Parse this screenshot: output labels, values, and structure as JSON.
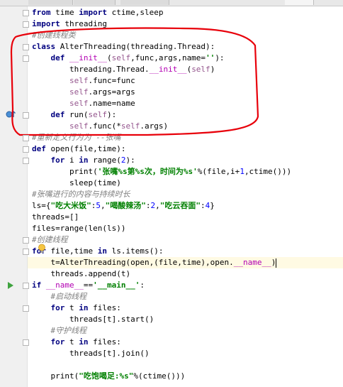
{
  "editor": {
    "lines": [
      [
        {
          "t": "from ",
          "c": "k"
        },
        {
          "t": "time ",
          "c": ""
        },
        {
          "t": "import ",
          "c": "k"
        },
        {
          "t": "ctime,sleep",
          "c": ""
        }
      ],
      [
        {
          "t": "import ",
          "c": "k"
        },
        {
          "t": "threading",
          "c": ""
        }
      ],
      [
        {
          "t": "#创建线程类",
          "c": "c"
        }
      ],
      [
        {
          "t": "class ",
          "c": "k"
        },
        {
          "t": "AlterThreading(threading.Thread):",
          "c": ""
        }
      ],
      [
        {
          "t": "    def ",
          "c": "k"
        },
        {
          "t": "__init__",
          "c": "mg"
        },
        {
          "t": "(",
          "c": ""
        },
        {
          "t": "self",
          "c": "sf"
        },
        {
          "t": ",func,args,name=",
          "c": ""
        },
        {
          "t": "''",
          "c": "s"
        },
        {
          "t": "):",
          "c": ""
        }
      ],
      [
        {
          "t": "        threading.Thread.",
          "c": ""
        },
        {
          "t": "__init__",
          "c": "mg"
        },
        {
          "t": "(",
          "c": ""
        },
        {
          "t": "self",
          "c": "sf"
        },
        {
          "t": ")",
          "c": ""
        }
      ],
      [
        {
          "t": "        ",
          "c": ""
        },
        {
          "t": "self",
          "c": "sf"
        },
        {
          "t": ".func=func",
          "c": ""
        }
      ],
      [
        {
          "t": "        ",
          "c": ""
        },
        {
          "t": "self",
          "c": "sf"
        },
        {
          "t": ".args=args",
          "c": ""
        }
      ],
      [
        {
          "t": "        ",
          "c": ""
        },
        {
          "t": "self",
          "c": "sf"
        },
        {
          "t": ".name=name",
          "c": ""
        }
      ],
      [
        {
          "t": "    def ",
          "c": "k"
        },
        {
          "t": "run",
          "c": ""
        },
        {
          "t": "(",
          "c": ""
        },
        {
          "t": "self",
          "c": "sf"
        },
        {
          "t": "):",
          "c": ""
        }
      ],
      [
        {
          "t": "        ",
          "c": ""
        },
        {
          "t": "self",
          "c": "sf"
        },
        {
          "t": ".func(*",
          "c": ""
        },
        {
          "t": "self",
          "c": "sf"
        },
        {
          "t": ".args)",
          "c": ""
        }
      ],
      [
        {
          "t": "#重新定义行为为 --张嘴",
          "c": "c"
        }
      ],
      [
        {
          "t": "def ",
          "c": "k"
        },
        {
          "t": "open(file,time):",
          "c": ""
        }
      ],
      [
        {
          "t": "    for ",
          "c": "k"
        },
        {
          "t": "i ",
          "c": ""
        },
        {
          "t": "in ",
          "c": "k"
        },
        {
          "t": "range(",
          "c": ""
        },
        {
          "t": "2",
          "c": "n"
        },
        {
          "t": "):",
          "c": ""
        }
      ],
      [
        {
          "t": "        print(",
          "c": ""
        },
        {
          "t": "'张嘴%s第%s次，时间为%s'",
          "c": "s"
        },
        {
          "t": "%(file,i+",
          "c": ""
        },
        {
          "t": "1",
          "c": "n"
        },
        {
          "t": ",ctime()))",
          "c": ""
        }
      ],
      [
        {
          "t": "        sleep(time)",
          "c": ""
        }
      ],
      [
        {
          "t": "#张嘴进行的内容与持续时长",
          "c": "c"
        }
      ],
      [
        {
          "t": "ls={",
          "c": ""
        },
        {
          "t": "\"吃大米饭\"",
          "c": "s"
        },
        {
          "t": ":",
          "c": ""
        },
        {
          "t": "5",
          "c": "n"
        },
        {
          "t": ",",
          "c": ""
        },
        {
          "t": "\"喝酸辣汤\"",
          "c": "s"
        },
        {
          "t": ":",
          "c": ""
        },
        {
          "t": "2",
          "c": "n"
        },
        {
          "t": ",",
          "c": ""
        },
        {
          "t": "\"吃云吞面\"",
          "c": "s"
        },
        {
          "t": ":",
          "c": ""
        },
        {
          "t": "4",
          "c": "n"
        },
        {
          "t": "}",
          "c": ""
        }
      ],
      [
        {
          "t": "threads=[]",
          "c": ""
        }
      ],
      [
        {
          "t": "files=range(len(ls))",
          "c": ""
        }
      ],
      [
        {
          "t": "#创建线程",
          "c": "c"
        }
      ],
      [
        {
          "t": "for ",
          "c": "k"
        },
        {
          "t": "file,time ",
          "c": ""
        },
        {
          "t": "in ",
          "c": "k"
        },
        {
          "t": "ls.items():",
          "c": ""
        }
      ],
      [
        {
          "t": "    t=AlterThreading(open,(file,time),open.",
          "c": ""
        },
        {
          "t": "__name__",
          "c": "dn"
        },
        {
          "t": ")",
          "c": ""
        }
      ],
      [
        {
          "t": "    threads.append(t)",
          "c": ""
        }
      ],
      [
        {
          "t": "if ",
          "c": "k"
        },
        {
          "t": "__name__",
          "c": "dn"
        },
        {
          "t": "==",
          "c": ""
        },
        {
          "t": "'__main__'",
          "c": "s"
        },
        {
          "t": ":",
          "c": ""
        }
      ],
      [
        {
          "t": "    #启动线程",
          "c": "c"
        }
      ],
      [
        {
          "t": "    for ",
          "c": "k"
        },
        {
          "t": "t ",
          "c": ""
        },
        {
          "t": "in ",
          "c": "k"
        },
        {
          "t": "files:",
          "c": ""
        }
      ],
      [
        {
          "t": "        threads[t].start()",
          "c": ""
        }
      ],
      [
        {
          "t": "    #守护线程",
          "c": "c"
        }
      ],
      [
        {
          "t": "    for ",
          "c": "k"
        },
        {
          "t": "t ",
          "c": ""
        },
        {
          "t": "in ",
          "c": "k"
        },
        {
          "t": "files:",
          "c": ""
        }
      ],
      [
        {
          "t": "        threads[t].join()",
          "c": ""
        }
      ],
      [],
      [
        {
          "t": "    print(",
          "c": ""
        },
        {
          "t": "\"吃饱喝足:%s\"",
          "c": "s"
        },
        {
          "t": "%(ctime()))",
          "c": ""
        }
      ]
    ],
    "current_line": 22,
    "annotation_color": "#e8000a"
  },
  "colors": {
    "keyword": "#000080",
    "string": "#008000",
    "comment": "#808080",
    "self": "#94558d",
    "magic": "#b200b2"
  },
  "icons": {
    "gutter_override": "override-marker-icon",
    "gutter_run": "run-arrow-icon",
    "bulb": "intention-bulb-icon"
  }
}
